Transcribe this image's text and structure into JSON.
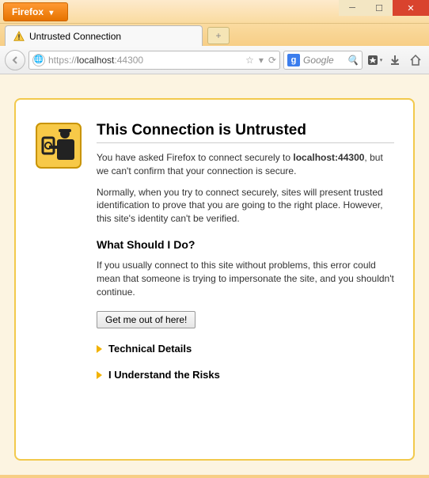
{
  "titlebar": {
    "menu_label": "Firefox"
  },
  "tab": {
    "title": "Untrusted Connection"
  },
  "navbar": {
    "url_protocol": "https://",
    "url_host": "localhost",
    "url_port": ":44300",
    "search_engine_letter": "g",
    "search_placeholder": "Google"
  },
  "page": {
    "heading": "This Connection is Untrusted",
    "para1_a": "You have asked Firefox to connect securely to ",
    "para1_host": "localhost:44300",
    "para1_b": ", but we can't confirm that your connection is secure.",
    "para2": "Normally, when you try to connect securely, sites will present trusted identification to prove that you are going to the right place. However, this site's identity can't be verified.",
    "subheading": "What Should I Do?",
    "para3": "If you usually connect to this site without problems, this error could mean that someone is trying to impersonate the site, and you shouldn't continue.",
    "button_label": "Get me out of here!",
    "expander1": "Technical Details",
    "expander2": "I Understand the Risks"
  }
}
